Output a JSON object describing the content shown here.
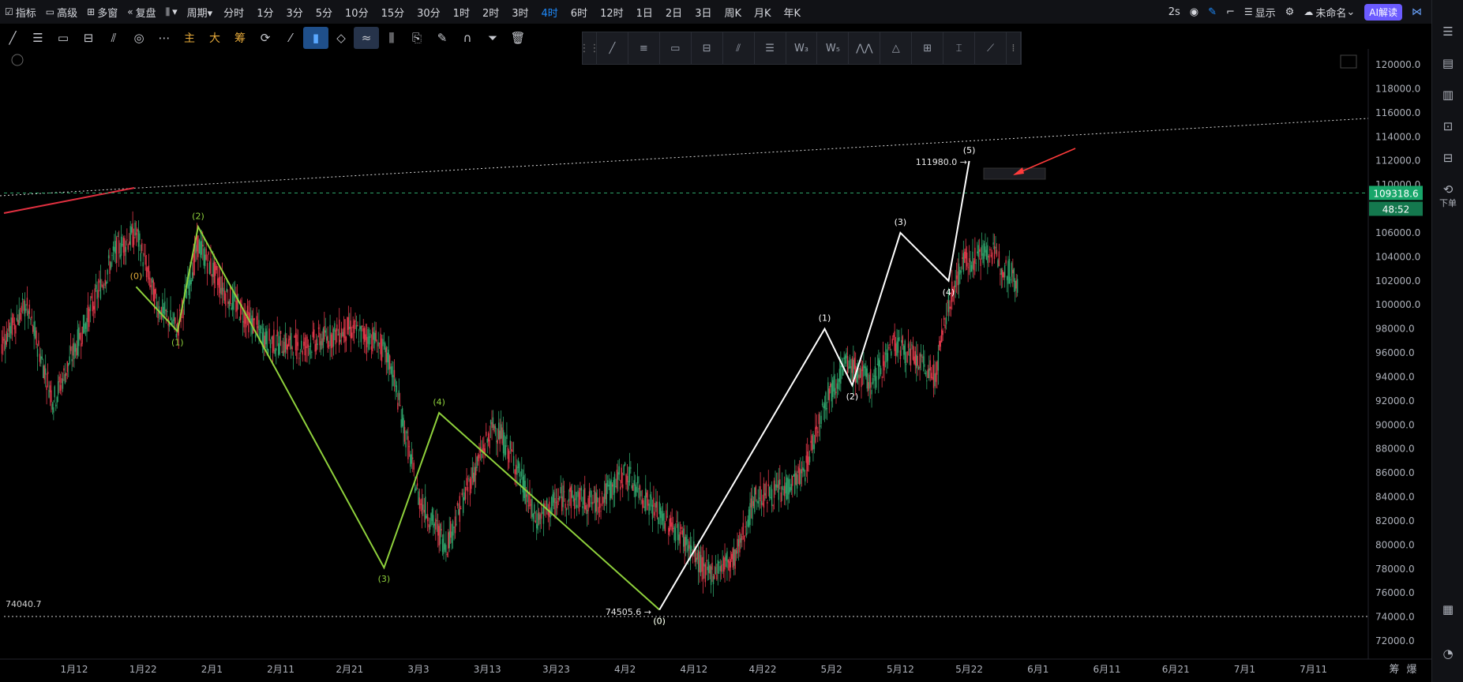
{
  "topbar": {
    "left": [
      {
        "icon": "indicator-icon",
        "label": "指标"
      },
      {
        "icon": "advanced-icon",
        "label": "高级"
      },
      {
        "icon": "multiwindow-icon",
        "label": "多窗"
      },
      {
        "icon": "replay-icon",
        "label": "复盘"
      },
      {
        "icon": "charttype-icon",
        "label": "▾"
      },
      {
        "icon": "",
        "label": "周期▾"
      }
    ],
    "timeframes": [
      "分时",
      "1分",
      "3分",
      "5分",
      "10分",
      "15分",
      "30分",
      "1时",
      "2时",
      "3时",
      "4时",
      "6时",
      "12时",
      "1日",
      "2日",
      "3日",
      "周K",
      "月K",
      "年K"
    ],
    "active_timeframe": "4时",
    "right": {
      "interval": "2s",
      "display": "显示",
      "cloud_name": "未命名",
      "ai": "AI解读"
    }
  },
  "toolbar2": {
    "cn_buttons": [
      "主",
      "大",
      "筹"
    ]
  },
  "chart_data": {
    "type": "candlestick",
    "x_tick_labels": [
      "1月12",
      "1月22",
      "2月1",
      "2月11",
      "2月21",
      "3月3",
      "3月13",
      "3月23",
      "4月2",
      "4月12",
      "4月22",
      "5月2",
      "5月12",
      "5月22",
      "6月1",
      "6月11",
      "6月21",
      "7月1",
      "7月11"
    ],
    "y_tick_labels": [
      "72000.0",
      "74000.0",
      "76000.0",
      "78000.0",
      "80000.0",
      "82000.0",
      "84000.0",
      "86000.0",
      "88000.0",
      "90000.0",
      "92000.0",
      "94000.0",
      "96000.0",
      "98000.0",
      "100000.0",
      "102000.0",
      "104000.0",
      "106000.0",
      "108000.0",
      "110000.0",
      "112000.0",
      "114000.0",
      "116000.0",
      "118000.0",
      "120000.0"
    ],
    "ylim": [
      71000,
      121500
    ],
    "last_price": "109318.6",
    "countdown": "48:52",
    "high_label": "111980.0",
    "low_label": "74505.6",
    "line_level_label": "74040.7",
    "green_wave": {
      "points": [
        [
          "1月21",
          101500
        ],
        [
          "1月27",
          97800
        ],
        [
          "1月30",
          106500
        ],
        [
          "2月26",
          78100
        ],
        [
          "3月6",
          91000
        ],
        [
          "4月7",
          74600
        ]
      ],
      "labels": [
        "(0)",
        "(1)",
        "(2)",
        "(3)",
        "(4)",
        "(0)"
      ]
    },
    "white_wave": {
      "points": [
        [
          "4月7",
          74600
        ],
        [
          "5月1",
          98000
        ],
        [
          "5月5",
          93300
        ],
        [
          "5月12",
          106000
        ],
        [
          "5月19",
          102000
        ],
        [
          "5月22",
          111980
        ]
      ],
      "labels": [
        "(0)",
        "(1)",
        "(2)",
        "(3)",
        "(4)",
        "(5)"
      ]
    },
    "colors": {
      "up": "#2fa26a",
      "down": "#e0384a",
      "green_wave": "#8fd13c",
      "white_wave": "#ffffff",
      "price_tag": "#18a66a",
      "orange_label": "#e0a93a",
      "red_arrow": "#ff3b3b"
    }
  },
  "bottombar": {
    "right_labels": [
      "筹",
      "爆"
    ]
  },
  "rightbar": {
    "order_label": "下单"
  }
}
